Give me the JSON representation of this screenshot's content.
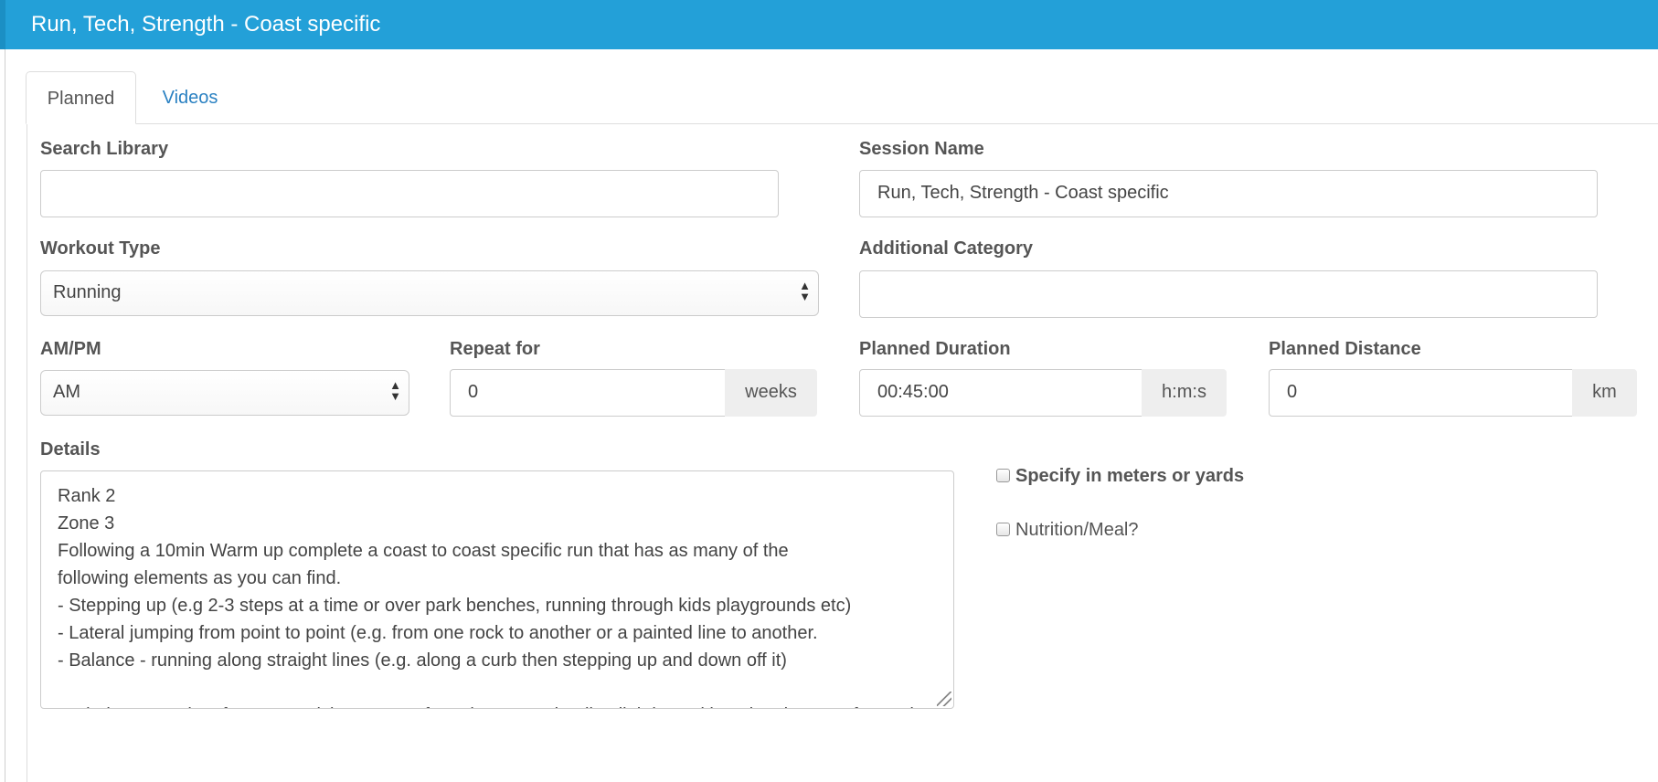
{
  "header": {
    "title": "Run, Tech, Strength - Coast specific"
  },
  "tabs": [
    {
      "label": "Planned",
      "active": true
    },
    {
      "label": "Videos",
      "active": false
    }
  ],
  "form": {
    "search_library": {
      "label": "Search Library",
      "value": ""
    },
    "session_name": {
      "label": "Session Name",
      "value": "Run, Tech, Strength - Coast specific"
    },
    "workout_type": {
      "label": "Workout Type",
      "value": "Running"
    },
    "additional_category": {
      "label": "Additional Category",
      "value": ""
    },
    "am_pm": {
      "label": "AM/PM",
      "value": "AM"
    },
    "repeat_for": {
      "label": "Repeat for",
      "value": "0",
      "unit": "weeks"
    },
    "planned_duration": {
      "label": "Planned Duration",
      "value": "00:45:00",
      "unit": "h:m:s"
    },
    "planned_distance": {
      "label": "Planned Distance",
      "value": "0",
      "unit": "km"
    },
    "details": {
      "label": "Details",
      "lines": [
        "Rank 2",
        "Zone 3",
        "Following a 10min Warm up complete a coast to coast specific run that has as many of the",
        "following elements as you can find.",
        "- Stepping up (e.g 2-3 steps at a time or over park benches, running through kids playgrounds etc)",
        "- Lateral jumping from point to point (e.g. from one rock to another or a painted line to another.",
        "- Balance - running along straight lines (e.g. along a curb then stepping up and down off it)",
        "",
        "Technique - Look to focus on quick, accurate foot placement, landing lightly, and keeping the eyes forward"
      ]
    },
    "specify_meters_yards": {
      "label": "Specify in meters or yards",
      "checked": false
    },
    "nutrition_meal": {
      "label": "Nutrition/Meal?",
      "checked": false
    }
  },
  "colors": {
    "header_bg": "#23a0d8",
    "link": "#2a81c2"
  },
  "icons": {
    "select_arrow": "up-down-arrows-icon",
    "resize": "resize-handle-icon"
  }
}
